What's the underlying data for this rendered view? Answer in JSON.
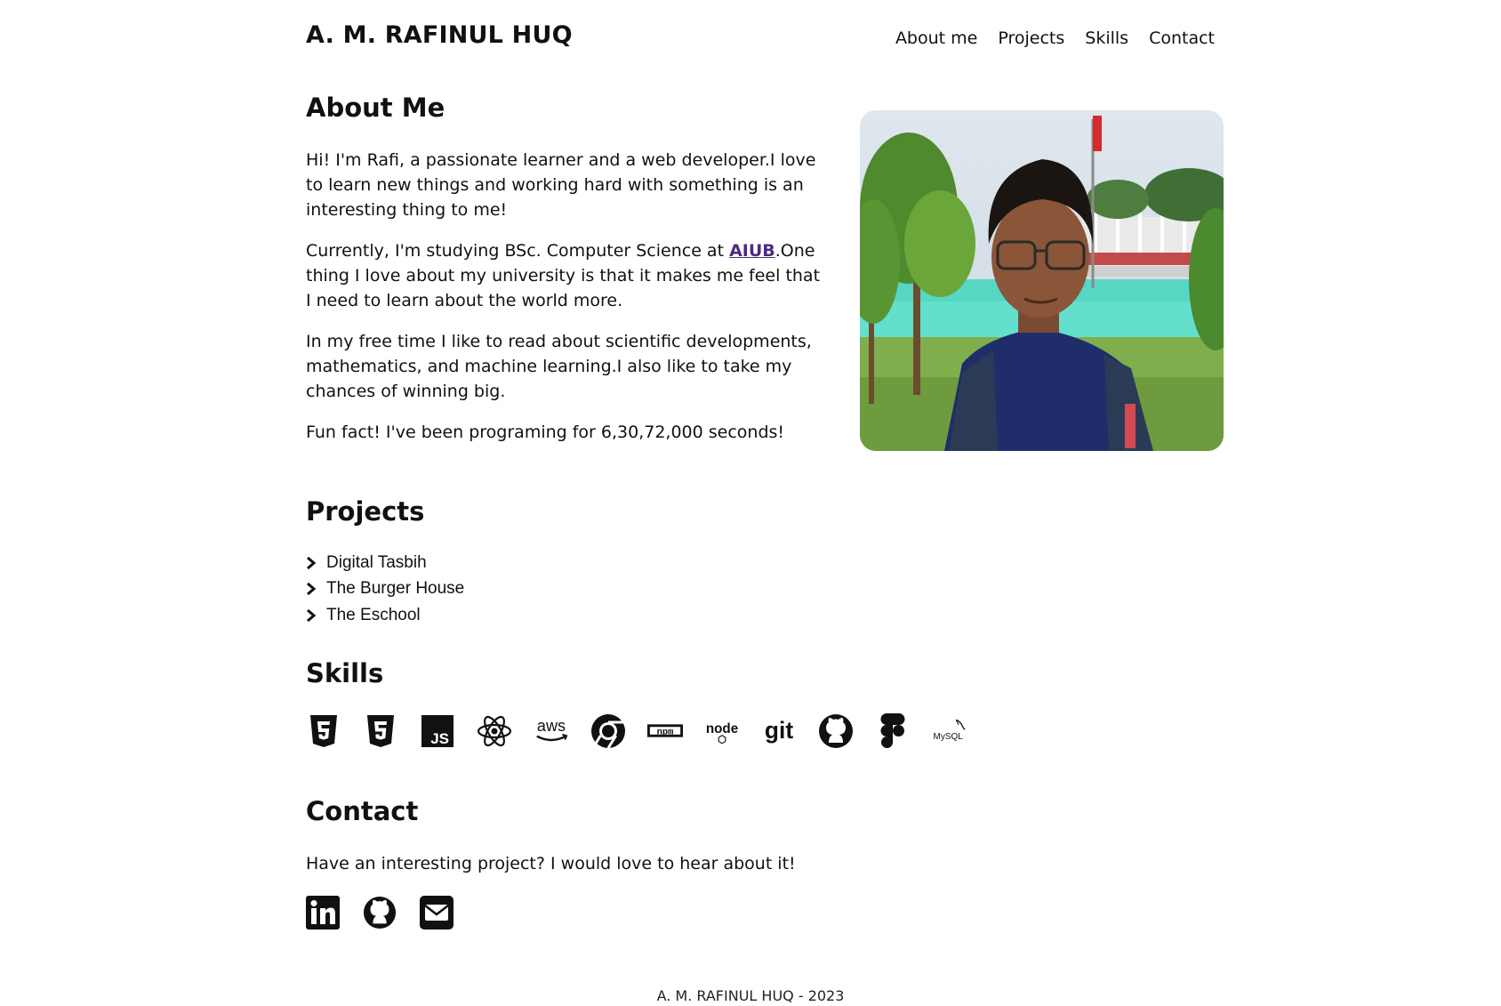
{
  "header": {
    "site_title": "A. M. RAFINUL HUQ",
    "nav": [
      "About me",
      "Projects",
      "Skills",
      "Contact"
    ]
  },
  "about": {
    "heading": "About Me",
    "p1": "Hi! I'm Rafi, a passionate learner and a web developer.I love to learn new things and working hard with something is an interesting thing to me!",
    "p2_before": "Currently, I'm studying BSc. Computer Science at ",
    "p2_link": "AIUB",
    "p2_after": ".One thing I love about my university is that it makes me feel that I need to learn about the world more.",
    "p3": "In my free time I like to read about scientific developments, mathematics, and machine learning.I also like to take my chances of winning big.",
    "p4": "Fun fact! I've been programing for 6,30,72,000 seconds!"
  },
  "projects": {
    "heading": "Projects",
    "items": [
      "Digital Tasbih",
      "The Burger House",
      "The Eschool"
    ]
  },
  "skills": {
    "heading": "Skills",
    "icons": [
      "html5-icon",
      "css3-icon",
      "javascript-icon",
      "react-icon",
      "aws-icon",
      "chrome-icon",
      "npm-icon",
      "nodejs-icon",
      "git-icon",
      "github-icon",
      "figma-icon",
      "mysql-icon"
    ],
    "labels": {
      "js": "JS",
      "aws": "aws",
      "npm": "npm",
      "node": "node",
      "git": "git",
      "mysql": "MySQL"
    }
  },
  "contact": {
    "heading": "Contact",
    "text": "Have an interesting project? I would love to hear about it!",
    "icons": [
      "linkedin-icon",
      "github-icon",
      "email-icon"
    ]
  },
  "footer": {
    "text": "A. M. RAFINUL HUQ - 2023"
  },
  "colors": {
    "text": "#111111",
    "link": "#4b2a7f",
    "background": "#ffffff"
  }
}
